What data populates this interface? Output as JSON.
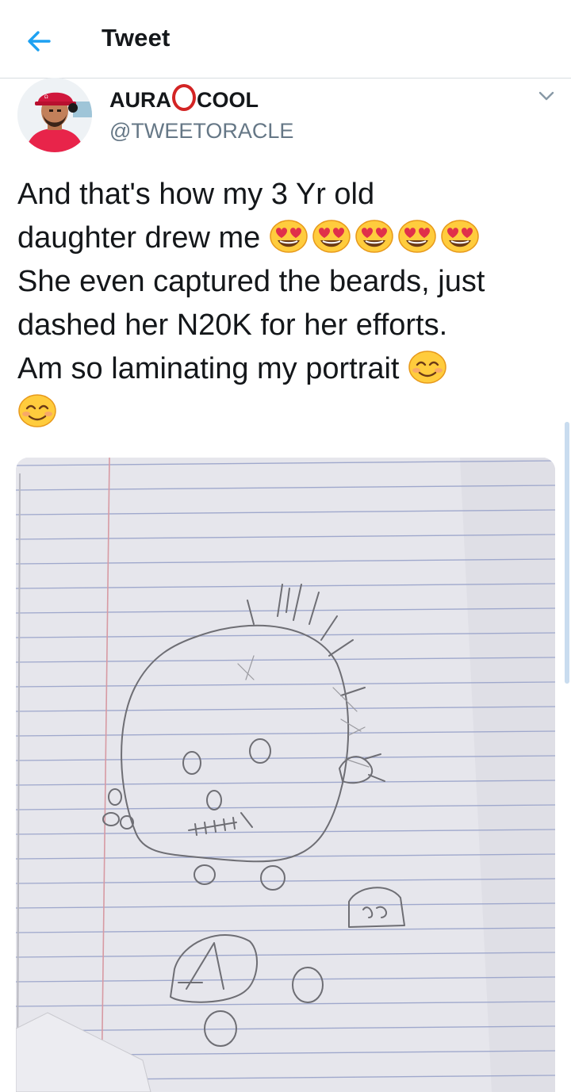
{
  "header": {
    "title": "Tweet"
  },
  "tweet": {
    "author": {
      "name_part1": "AURA",
      "name_part2": "COOL",
      "handle": "@TWEETORACLE",
      "avatar_icon": "profile-photo-man-red-cap"
    },
    "lines": [
      "And that's how my 3 Yr old",
      "daughter drew me",
      "She even captured the beards, just",
      "dashed her N20K for her efforts.",
      "Am so laminating my portrait"
    ],
    "emoji": {
      "heart_eyes": "smiling-face-with-heart-eyes",
      "smile": "smiling-face-with-smiling-eyes"
    },
    "media": {
      "description_icon": "pencil-drawing-on-notebook-paper"
    }
  },
  "colors": {
    "accent": "#1da1f2",
    "ring": "#d32424",
    "secondary_text": "#657786"
  }
}
